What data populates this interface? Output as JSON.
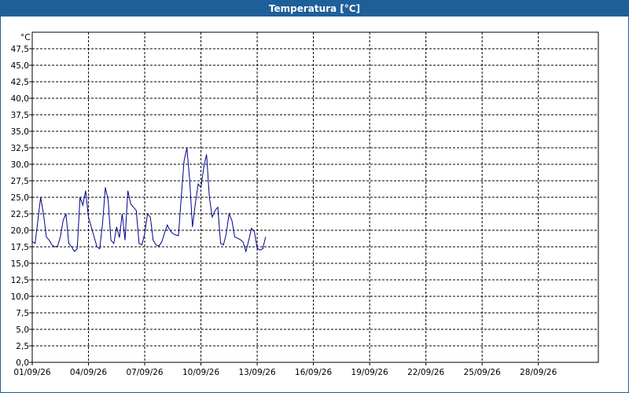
{
  "window": {
    "title": "Temperatura [°C]"
  },
  "chart_data": {
    "type": "line",
    "title": "Temperatura [°C]",
    "ylabel": "°C",
    "xlabel": "",
    "x_tick_labels": [
      "01/09/26",
      "04/09/26",
      "07/09/26",
      "10/09/26",
      "13/09/26",
      "16/09/26",
      "19/09/26",
      "22/09/26",
      "25/09/26",
      "28/09/26"
    ],
    "y_tick_labels": [
      "0,0",
      "2,5",
      "5,0",
      "7,5",
      "10,0",
      "12,5",
      "15,0",
      "17,5",
      "20,0",
      "22,5",
      "25,0",
      "27,5",
      "30,0",
      "32,5",
      "35,0",
      "37,5",
      "40,0",
      "42,5",
      "45,0",
      "47,5"
    ],
    "xlim_days": [
      0,
      30.2
    ],
    "ylim": [
      0,
      50
    ],
    "grid": true,
    "line_color": "#00008b",
    "series": [
      {
        "x": [
          0.0,
          0.15,
          0.3,
          0.45,
          0.6,
          0.75,
          0.9,
          1.05,
          1.2,
          1.35,
          1.5,
          1.65,
          1.8,
          1.95,
          2.1,
          2.25,
          2.4,
          2.55,
          2.7,
          2.85,
          3.0,
          3.15,
          3.3,
          3.45,
          3.6,
          3.75,
          3.9,
          4.05,
          4.2,
          4.35,
          4.5,
          4.65,
          4.8,
          4.95,
          5.1,
          5.25,
          5.4,
          5.55,
          5.7,
          5.85,
          6.0,
          6.15,
          6.3,
          6.45,
          6.6,
          6.75,
          6.9,
          7.05,
          7.2,
          7.35,
          7.5,
          7.65,
          7.8,
          7.95,
          8.1,
          8.25,
          8.4,
          8.55,
          8.7,
          8.85,
          9.0,
          9.15,
          9.3,
          9.45,
          9.6,
          9.75,
          9.9,
          10.05,
          10.2,
          10.35,
          10.5,
          10.65,
          10.8,
          10.95,
          11.1,
          11.25,
          11.4,
          11.55,
          11.7,
          11.85,
          12.0,
          12.15,
          12.3,
          12.45
        ],
        "y": [
          18.3,
          18.0,
          21.5,
          25.0,
          22.5,
          19.0,
          18.5,
          17.8,
          17.5,
          17.6,
          19.0,
          21.5,
          22.5,
          18.0,
          17.5,
          16.8,
          17.2,
          25.0,
          23.8,
          26.0,
          22.0,
          20.5,
          19.0,
          17.5,
          17.2,
          21.0,
          26.5,
          24.5,
          18.5,
          18.0,
          20.5,
          18.9,
          22.5,
          18.5,
          26.0,
          24.0,
          23.5,
          23.0,
          18.0,
          17.8,
          19.5,
          22.5,
          22.0,
          18.5,
          17.8,
          17.6,
          18.2,
          19.5,
          20.8,
          20.0,
          19.5,
          19.3,
          19.2,
          25.0,
          30.5,
          32.5,
          27.5,
          20.5,
          24.0,
          27.0,
          26.5,
          29.5,
          31.5,
          25.0,
          22.0,
          23.0,
          23.5,
          18.0,
          17.8,
          19.5,
          22.5,
          21.5,
          19.0,
          18.8,
          18.6,
          18.2,
          16.8,
          18.5,
          20.3,
          19.8,
          17.3,
          17.0,
          17.2,
          19.0
        ]
      }
    ]
  }
}
